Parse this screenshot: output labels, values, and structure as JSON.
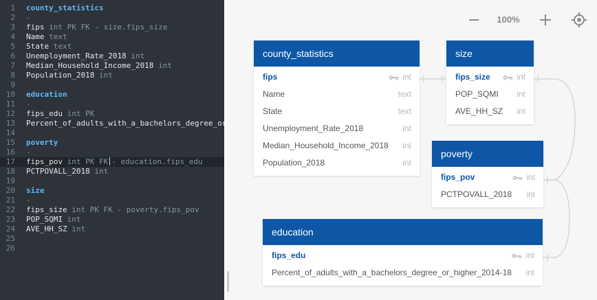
{
  "editor": {
    "lines": [
      {
        "n": "1",
        "kind": "title",
        "text": "county_statistics"
      },
      {
        "n": "2",
        "kind": "dash",
        "text": "-"
      },
      {
        "n": "3",
        "kind": "field",
        "name": "fips",
        "rest": "int PK FK - size.fips_size"
      },
      {
        "n": "4",
        "kind": "field",
        "name": "Name",
        "rest": "text"
      },
      {
        "n": "5",
        "kind": "field",
        "name": "State",
        "rest": "text"
      },
      {
        "n": "6",
        "kind": "field",
        "name": "Unemployment_Rate_2018",
        "rest": "int"
      },
      {
        "n": "7",
        "kind": "field",
        "name": "Median_Household_Income_2018",
        "rest": "int"
      },
      {
        "n": "8",
        "kind": "field",
        "name": "Population_2018",
        "rest": "int"
      },
      {
        "n": "9",
        "kind": "blank",
        "text": ""
      },
      {
        "n": "10",
        "kind": "title",
        "text": "education"
      },
      {
        "n": "11",
        "kind": "dash",
        "text": "-"
      },
      {
        "n": "12",
        "kind": "field",
        "name": "fips_edu",
        "rest": "int PK"
      },
      {
        "n": "13",
        "kind": "plain",
        "text": "Percent_of_adults_with_a_bachelors_degree_or"
      },
      {
        "n": "14",
        "kind": "blank",
        "text": ""
      },
      {
        "n": "15",
        "kind": "title",
        "text": "poverty"
      },
      {
        "n": "16",
        "kind": "dash",
        "text": "-"
      },
      {
        "n": "17",
        "kind": "cursor",
        "name": "fips_pov",
        "rest": "int PK FK",
        "rest2": "- education.fips_edu"
      },
      {
        "n": "18",
        "kind": "field",
        "name": "PCTPOVALL_2018",
        "rest": "int"
      },
      {
        "n": "19",
        "kind": "blank",
        "text": ""
      },
      {
        "n": "20",
        "kind": "title",
        "text": "size"
      },
      {
        "n": "21",
        "kind": "dash",
        "text": "-"
      },
      {
        "n": "22",
        "kind": "field",
        "name": "fips_size",
        "rest": "int PK FK - poverty.fips_pov"
      },
      {
        "n": "23",
        "kind": "field",
        "name": "POP_SQMI",
        "rest": "int"
      },
      {
        "n": "24",
        "kind": "field",
        "name": "AVE_HH_SZ",
        "rest": "int"
      },
      {
        "n": "25",
        "kind": "blank",
        "text": ""
      },
      {
        "n": "26",
        "kind": "blank",
        "text": ""
      }
    ],
    "active_line": "17"
  },
  "toolbar": {
    "zoom_out_label": "—",
    "zoom_level": "100%",
    "zoom_in_label": "+",
    "locate_icon": "crosshair-icon"
  },
  "tables": {
    "county_statistics": {
      "title": "county_statistics",
      "fields": [
        {
          "name": "fips",
          "type": "int",
          "pk": true
        },
        {
          "name": "Name",
          "type": "text",
          "pk": false
        },
        {
          "name": "State",
          "type": "text",
          "pk": false
        },
        {
          "name": "Unemployment_Rate_2018",
          "type": "int",
          "pk": false
        },
        {
          "name": "Median_Household_Income_2018",
          "type": "int",
          "pk": false
        },
        {
          "name": "Population_2018",
          "type": "int",
          "pk": false
        }
      ]
    },
    "size": {
      "title": "size",
      "fields": [
        {
          "name": "fips_size",
          "type": "int",
          "pk": true
        },
        {
          "name": "POP_SQMI",
          "type": "int",
          "pk": false
        },
        {
          "name": "AVE_HH_SZ",
          "type": "int",
          "pk": false
        }
      ]
    },
    "poverty": {
      "title": "poverty",
      "fields": [
        {
          "name": "fips_pov",
          "type": "int",
          "pk": true
        },
        {
          "name": "PCTPOVALL_2018",
          "type": "int",
          "pk": false
        }
      ]
    },
    "education": {
      "title": "education",
      "fields": [
        {
          "name": "fips_edu",
          "type": "int",
          "pk": true
        },
        {
          "name": "Percent_of_adults_with_a_bachelors_degree_or_higher_2014-18",
          "type": "int",
          "pk": false
        }
      ]
    }
  },
  "colors": {
    "header_blue": "#0d57a6",
    "editor_bg": "#2d3339",
    "editor_title": "#5fb7f6"
  }
}
